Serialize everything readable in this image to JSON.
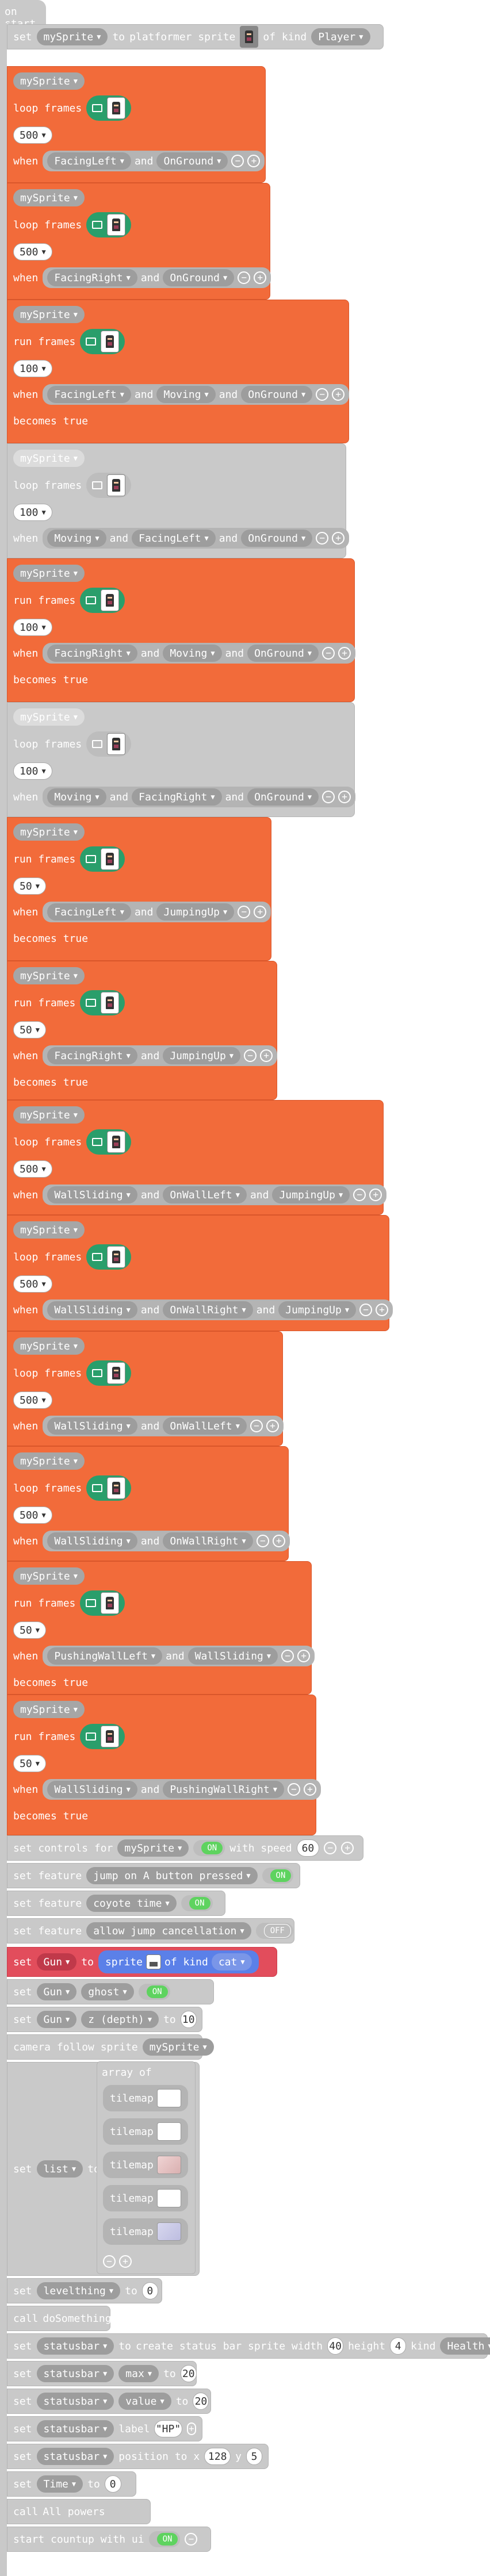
{
  "hat": {
    "label": "on start"
  },
  "labels": {
    "set": "set",
    "to": "to",
    "platformer_sprite": "platformer sprite",
    "of_kind": "of kind",
    "loop_frames": "loop frames",
    "run_frames": "run frames",
    "when": "when",
    "and": "and",
    "becomes_true": "becomes true",
    "set_controls_for": "set controls for",
    "with_speed": "with speed",
    "set_feature": "set feature",
    "sprite": "sprite",
    "camera_follow_sprite": "camera follow sprite",
    "array_of": "array of",
    "tilemap": "tilemap",
    "call": "call",
    "create_status_bar": "create status bar sprite width",
    "height": "height",
    "kind": "kind",
    "label": "label",
    "position_to_x": "position to x",
    "start_countup": "start countup with ui",
    "on": "ON",
    "off": "OFF"
  },
  "vars": {
    "mySprite": "mySprite",
    "player": "Player",
    "gun": "Gun",
    "cat": "cat",
    "ghost": "ghost",
    "z_depth": "z (depth)",
    "list": "list",
    "levelthing": "levelthing",
    "statusbar": "statusbar",
    "max": "max",
    "value": "value",
    "health": "Health",
    "time": "Time"
  },
  "anim_blocks": [
    {
      "type": "loop frames",
      "interval": "500",
      "conds": [
        "FacingLeft",
        "OnGround"
      ],
      "becomes": false,
      "color": "orange"
    },
    {
      "type": "loop frames",
      "interval": "500",
      "conds": [
        "FacingRight",
        "OnGround"
      ],
      "becomes": false,
      "color": "orange"
    },
    {
      "type": "run frames",
      "interval": "100",
      "conds": [
        "FacingLeft",
        "Moving",
        "OnGround"
      ],
      "becomes": true,
      "color": "orange"
    },
    {
      "type": "loop frames",
      "interval": "100",
      "conds": [
        "Moving",
        "FacingLeft",
        "OnGround"
      ],
      "becomes": false,
      "color": "grey"
    },
    {
      "type": "run frames",
      "interval": "100",
      "conds": [
        "FacingRight",
        "Moving",
        "OnGround"
      ],
      "becomes": true,
      "color": "orange"
    },
    {
      "type": "loop frames",
      "interval": "100",
      "conds": [
        "Moving",
        "FacingRight",
        "OnGround"
      ],
      "becomes": false,
      "color": "grey"
    },
    {
      "type": "run frames",
      "interval": "50",
      "conds": [
        "FacingLeft",
        "JumpingUp"
      ],
      "becomes": true,
      "color": "orange"
    },
    {
      "type": "run frames",
      "interval": "50",
      "conds": [
        "FacingRight",
        "JumpingUp"
      ],
      "becomes": true,
      "color": "orange"
    },
    {
      "type": "loop frames",
      "interval": "500",
      "conds": [
        "WallSliding",
        "OnWallLeft",
        "JumpingUp"
      ],
      "becomes": false,
      "color": "orange"
    },
    {
      "type": "loop frames",
      "interval": "500",
      "conds": [
        "WallSliding",
        "OnWallRight",
        "JumpingUp"
      ],
      "becomes": false,
      "color": "orange"
    },
    {
      "type": "loop frames",
      "interval": "500",
      "conds": [
        "WallSliding",
        "OnWallLeft"
      ],
      "becomes": false,
      "color": "orange"
    },
    {
      "type": "loop frames",
      "interval": "500",
      "conds": [
        "WallSliding",
        "OnWallRight"
      ],
      "becomes": false,
      "color": "orange"
    },
    {
      "type": "run frames",
      "interval": "50",
      "conds": [
        "PushingWallLeft",
        "WallSliding"
      ],
      "becomes": true,
      "color": "orange"
    },
    {
      "type": "run frames",
      "interval": "50",
      "conds": [
        "WallSliding",
        "PushingWallRight"
      ],
      "becomes": true,
      "color": "orange"
    }
  ],
  "values": {
    "speed": "60",
    "z": "10",
    "levelthing": "0",
    "sb_width": "40",
    "sb_height": "4",
    "sb_max": "20",
    "sb_value": "20",
    "sb_label": "HP",
    "pos_x": "128",
    "pos_y": "5",
    "time": "0"
  },
  "features": {
    "jump": "jump on A button pressed",
    "coyote": "coyote time",
    "cancel": "allow jump cancellation"
  },
  "calls": {
    "doSomething": "doSomething",
    "all_powers": "All powers"
  },
  "colors": {
    "orange": "#f26b3a",
    "grey": "#c9c9c9",
    "green": "#2a9e6b",
    "red": "#e24d5c",
    "blue": "#5b80e8"
  }
}
